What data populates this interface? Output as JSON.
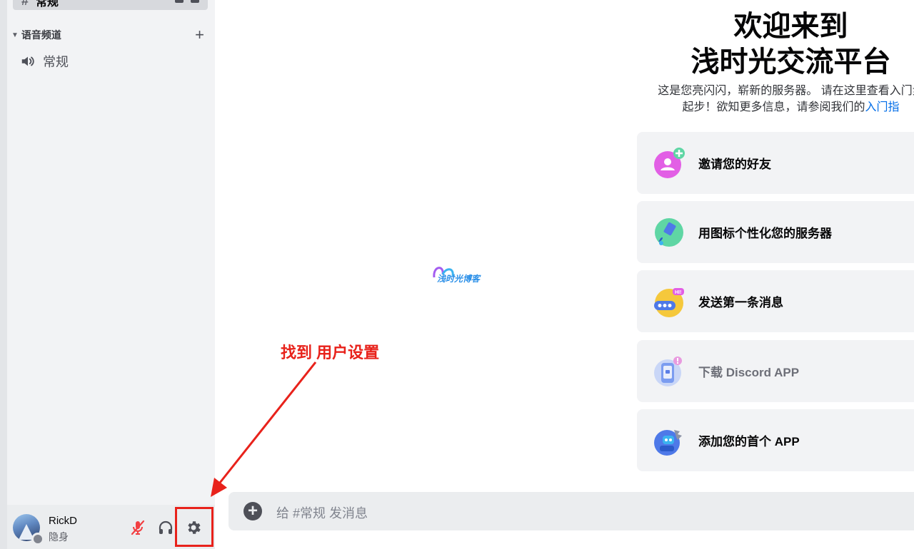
{
  "sidebar": {
    "top_channel_label": "常规",
    "category_label": "语音频道",
    "voice_channel_label": "常规"
  },
  "user_panel": {
    "username": "RickD",
    "status": "隐身"
  },
  "annotation": {
    "text": "找到 用户设置",
    "color": "#e8221b"
  },
  "logo": {
    "text": "浅时光博客"
  },
  "welcome": {
    "title_line1": "欢迎来到",
    "title_line2": "浅时光交流平台",
    "desc_line1": "这是您亮闪闪，崭新的服务器。 请在这里查看入门步",
    "desc_line2_prefix": "起步！欲知更多信息，请参阅我们的",
    "desc_link": "入门指"
  },
  "cards": [
    {
      "label": "邀请您的好友",
      "icon": "invite-friends-icon"
    },
    {
      "label": "用图标个性化您的服务器",
      "icon": "paintbrush-icon"
    },
    {
      "label": "发送第一条消息",
      "icon": "chat-bubble-icon"
    },
    {
      "label": "下载 Discord APP",
      "icon": "phone-download-icon"
    },
    {
      "label": "添加您的首个 APP",
      "icon": "robot-app-icon"
    }
  ],
  "composer": {
    "placeholder": "给 #常规 发消息"
  },
  "colors": {
    "accent_red": "#e8221b",
    "link_blue": "#006ce7",
    "sidebar_bg": "#f2f3f5"
  }
}
